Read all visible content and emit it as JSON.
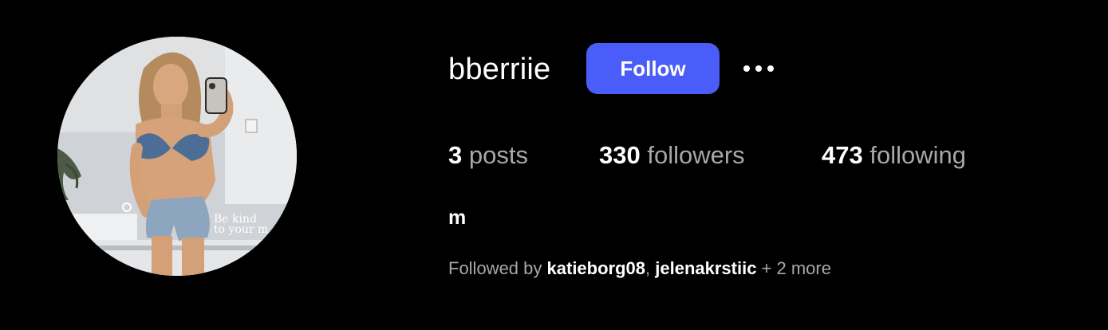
{
  "profile": {
    "username": "bberriie",
    "follow_label": "Follow",
    "more_label": "More options",
    "avatar_caption_line1": "Be kind",
    "avatar_caption_line2": "to your m"
  },
  "stats": {
    "posts_count": "3",
    "posts_label": "posts",
    "followers_count": "330",
    "followers_label": "followers",
    "following_count": "473",
    "following_label": "following"
  },
  "bio": {
    "text": "m"
  },
  "followed_by": {
    "prefix": "Followed by ",
    "names": [
      "katieborg08",
      "jelenakrstiic"
    ],
    "separator": ", ",
    "more": " + 2 more"
  },
  "colors": {
    "background": "#000000",
    "accent": "#4a5df9",
    "primary_text": "#ffffff",
    "secondary_text": "#a8a8a8"
  },
  "icons": {
    "more": "ellipsis-icon"
  }
}
